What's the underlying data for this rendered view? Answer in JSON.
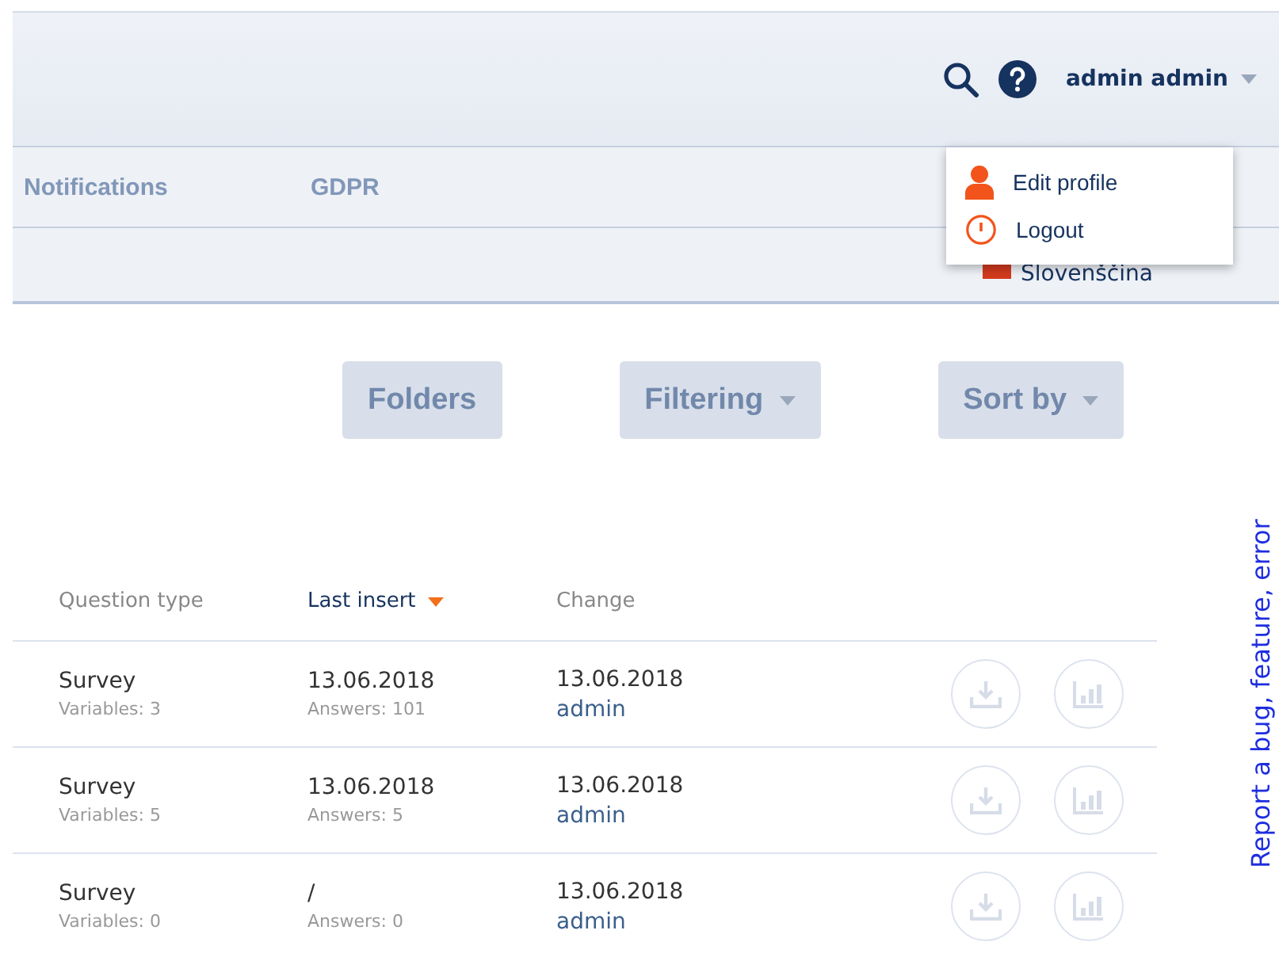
{
  "header": {
    "user": "admin admin",
    "menu": [
      {
        "kind": "profile",
        "label": "Edit profile"
      },
      {
        "kind": "logout",
        "label": "Logout"
      }
    ]
  },
  "nav": [
    "Notifications",
    "GDPR"
  ],
  "language": "Slovenščina",
  "toolbar": [
    {
      "label": "Folders",
      "dropdown": false
    },
    {
      "label": "Filtering",
      "dropdown": true
    },
    {
      "label": "Sort by",
      "dropdown": true
    }
  ],
  "table": {
    "columns": [
      {
        "label": "Question type",
        "sorted": false
      },
      {
        "label": "Last insert",
        "sorted": true
      },
      {
        "label": "Change",
        "sorted": false
      }
    ],
    "rows": [
      {
        "type": "Survey",
        "variables": "Variables: 3",
        "last_insert": "13.06.2018",
        "answers": "Answers: 101",
        "changed": "13.06.2018",
        "by": "admin"
      },
      {
        "type": "Survey",
        "variables": "Variables: 5",
        "last_insert": "13.06.2018",
        "answers": "Answers: 5",
        "changed": "13.06.2018",
        "by": "admin"
      },
      {
        "type": "Survey",
        "variables": "Variables: 0",
        "last_insert": "/",
        "answers": "Answers: 0",
        "changed": "13.06.2018",
        "by": "admin"
      }
    ]
  },
  "report_link": "Report a bug, feature, error"
}
